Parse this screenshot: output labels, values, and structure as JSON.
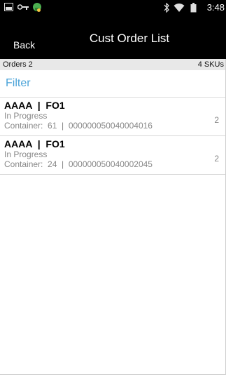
{
  "status_bar": {
    "time": "3:48",
    "icons": [
      "image-notification-icon",
      "key-icon",
      "android-notification-icon",
      "bluetooth-icon",
      "wifi-icon",
      "battery-icon"
    ]
  },
  "header": {
    "back_label": "Back",
    "title": "Cust Order List"
  },
  "summary": {
    "orders": "Orders 2",
    "skus": "4 SKUs"
  },
  "filter_label": "Filter",
  "orders": [
    {
      "title": "AAAA  |  FO1",
      "status": "In Progress",
      "container": "Container:  61  |  000000050040004016",
      "qty": "2"
    },
    {
      "title": "AAAA  |  FO1",
      "status": "In Progress",
      "container": "Container:  24  |  000000050040002045",
      "qty": "2"
    }
  ],
  "colors": {
    "accent": "#4aa3d8",
    "header_bg": "#000000",
    "summary_bg": "#e8e8e8",
    "secondary_text": "#888888"
  }
}
